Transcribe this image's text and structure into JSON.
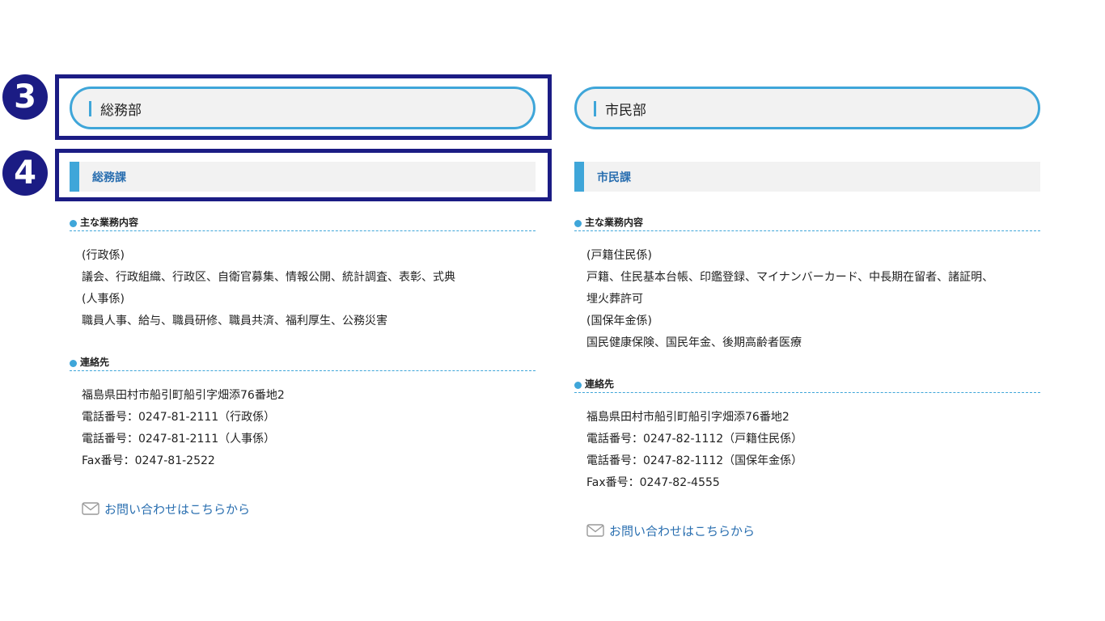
{
  "badges": {
    "three": "3",
    "four": "4"
  },
  "colors": {
    "accent": "#3fa6d9",
    "frame": "#1b1c84",
    "link": "#2a6fb0"
  },
  "left": {
    "department": "総務部",
    "section": "総務課",
    "duties_heading": "主な業務内容",
    "duties": [
      "(行政係)",
      "議会、行政組織、行政区、自衛官募集、情報公開、統計調査、表彰、式典",
      "(人事係)",
      "職員人事、給与、職員研修、職員共済、福利厚生、公務災害"
    ],
    "contact_heading": "連絡先",
    "contact": [
      "福島県田村市船引町船引字畑添76番地2",
      "電話番号：0247-81-2111（行政係）",
      "電話番号：0247-81-2111（人事係）",
      "Fax番号：0247-81-2522"
    ],
    "inquiry_link": "お問い合わせはこちらから"
  },
  "right": {
    "department": "市民部",
    "section": "市民課",
    "duties_heading": "主な業務内容",
    "duties": [
      "(戸籍住民係)",
      "戸籍、住民基本台帳、印鑑登録、マイナンバーカード、中長期在留者、諸証明、",
      "埋火葬許可",
      "(国保年金係)",
      "国民健康保険、国民年金、後期高齢者医療"
    ],
    "contact_heading": "連絡先",
    "contact": [
      "福島県田村市船引町船引字畑添76番地2",
      "電話番号：0247-82-1112（戸籍住民係）",
      "電話番号：0247-82-1112（国保年金係）",
      "Fax番号：0247-82-4555"
    ],
    "inquiry_link": "お問い合わせはこちらから"
  }
}
